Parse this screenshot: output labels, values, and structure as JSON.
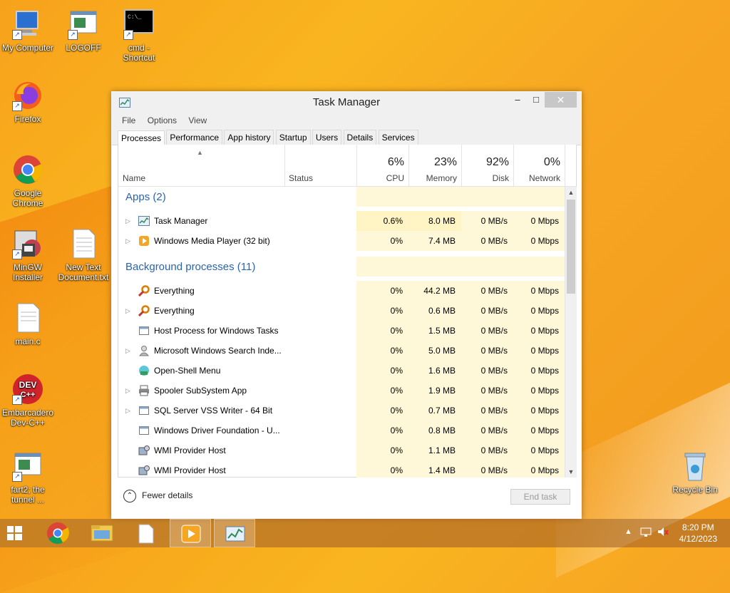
{
  "desktop": {
    "icons": [
      {
        "label": "My Computer"
      },
      {
        "label": "LOGOFF"
      },
      {
        "label": "cmd - Shortcut"
      },
      {
        "label": "Firefox"
      },
      {
        "label": "Google Chrome"
      },
      {
        "label": "MinGW Installer"
      },
      {
        "label": "New Text Document.txt"
      },
      {
        "label": "main.c"
      },
      {
        "label": "Embarcadero Dev-C++"
      },
      {
        "label": "fart2; the tunnel ..."
      },
      {
        "label": "Recycle Bin"
      }
    ]
  },
  "window": {
    "title": "Task Manager",
    "menu": [
      "File",
      "Options",
      "View"
    ],
    "tabs": [
      "Processes",
      "Performance",
      "App history",
      "Startup",
      "Users",
      "Details",
      "Services"
    ],
    "active_tab": "Processes",
    "columns": {
      "name": "Name",
      "status": "Status",
      "cpu": {
        "pct": "6%",
        "label": "CPU"
      },
      "memory": {
        "pct": "23%",
        "label": "Memory"
      },
      "disk": {
        "pct": "92%",
        "label": "Disk"
      },
      "network": {
        "pct": "0%",
        "label": "Network"
      }
    },
    "groups": {
      "apps": "Apps (2)",
      "background": "Background processes (11)"
    },
    "apps": [
      {
        "name": "Task Manager",
        "cpu": "0.6%",
        "memory": "8.0 MB",
        "disk": "0 MB/s",
        "network": "0 Mbps",
        "icon": "task-manager-icon",
        "expandable": true
      },
      {
        "name": "Windows Media Player (32 bit)",
        "cpu": "0%",
        "memory": "7.4 MB",
        "disk": "0 MB/s",
        "network": "0 Mbps",
        "icon": "media-player-icon",
        "expandable": true
      }
    ],
    "background": [
      {
        "name": "Everything",
        "cpu": "0%",
        "memory": "44.2 MB",
        "disk": "0 MB/s",
        "network": "0 Mbps",
        "icon": "magnifier-icon",
        "expandable": false
      },
      {
        "name": "Everything",
        "cpu": "0%",
        "memory": "0.6 MB",
        "disk": "0 MB/s",
        "network": "0 Mbps",
        "icon": "magnifier-icon",
        "expandable": true
      },
      {
        "name": "Host Process for Windows Tasks",
        "cpu": "0%",
        "memory": "1.5 MB",
        "disk": "0 MB/s",
        "network": "0 Mbps",
        "icon": "window-icon",
        "expandable": false
      },
      {
        "name": "Microsoft Windows Search Inde...",
        "cpu": "0%",
        "memory": "5.0 MB",
        "disk": "0 MB/s",
        "network": "0 Mbps",
        "icon": "search-user-icon",
        "expandable": true
      },
      {
        "name": "Open-Shell Menu",
        "cpu": "0%",
        "memory": "1.6 MB",
        "disk": "0 MB/s",
        "network": "0 Mbps",
        "icon": "shell-icon",
        "expandable": false
      },
      {
        "name": "Spooler SubSystem App",
        "cpu": "0%",
        "memory": "1.9 MB",
        "disk": "0 MB/s",
        "network": "0 Mbps",
        "icon": "printer-icon",
        "expandable": true
      },
      {
        "name": "SQL Server VSS Writer - 64 Bit",
        "cpu": "0%",
        "memory": "0.7 MB",
        "disk": "0 MB/s",
        "network": "0 Mbps",
        "icon": "window-icon",
        "expandable": true
      },
      {
        "name": "Windows Driver Foundation - U...",
        "cpu": "0%",
        "memory": "0.8 MB",
        "disk": "0 MB/s",
        "network": "0 Mbps",
        "icon": "window-icon",
        "expandable": false
      },
      {
        "name": "WMI Provider Host",
        "cpu": "0%",
        "memory": "1.1 MB",
        "disk": "0 MB/s",
        "network": "0 Mbps",
        "icon": "wmi-icon",
        "expandable": false
      },
      {
        "name": "WMI Provider Host",
        "cpu": "0%",
        "memory": "1.4 MB",
        "disk": "0 MB/s",
        "network": "0 Mbps",
        "icon": "wmi-icon",
        "expandable": false
      }
    ],
    "footer": {
      "fewer_details": "Fewer details",
      "end_task": "End task"
    }
  },
  "taskbar": {
    "time": "8:20 PM",
    "date": "4/12/2023"
  },
  "colors": {
    "group_header": "#2a63b0",
    "heat_light": "#fff8d8",
    "heat_medium": "#fff4c4"
  }
}
